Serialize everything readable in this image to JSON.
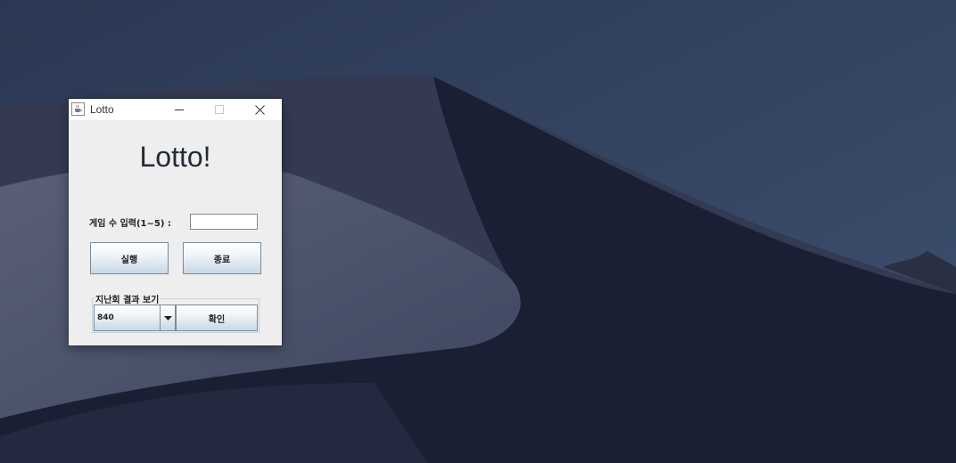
{
  "window": {
    "title": "Lotto",
    "heading": "Lotto!"
  },
  "form": {
    "games_label": "게임 수 입력(1~5) :",
    "games_value": "",
    "run_label": "실행",
    "exit_label": "종료"
  },
  "past_results": {
    "group_title": "지난회 결과 보기",
    "selected_round": "840",
    "confirm_label": "확인"
  },
  "icons": {
    "app": "java-cup-icon",
    "minimize": "minimize-icon",
    "maximize": "maximize-icon",
    "close": "close-icon",
    "dropdown": "triangle-down-icon"
  },
  "colors": {
    "window_bg": "#eeeeee",
    "button_gradient_bottom": "#c7d7e7",
    "wallpaper_sky": "#2c3a55",
    "wallpaper_dune_dark": "#1a1f33"
  }
}
